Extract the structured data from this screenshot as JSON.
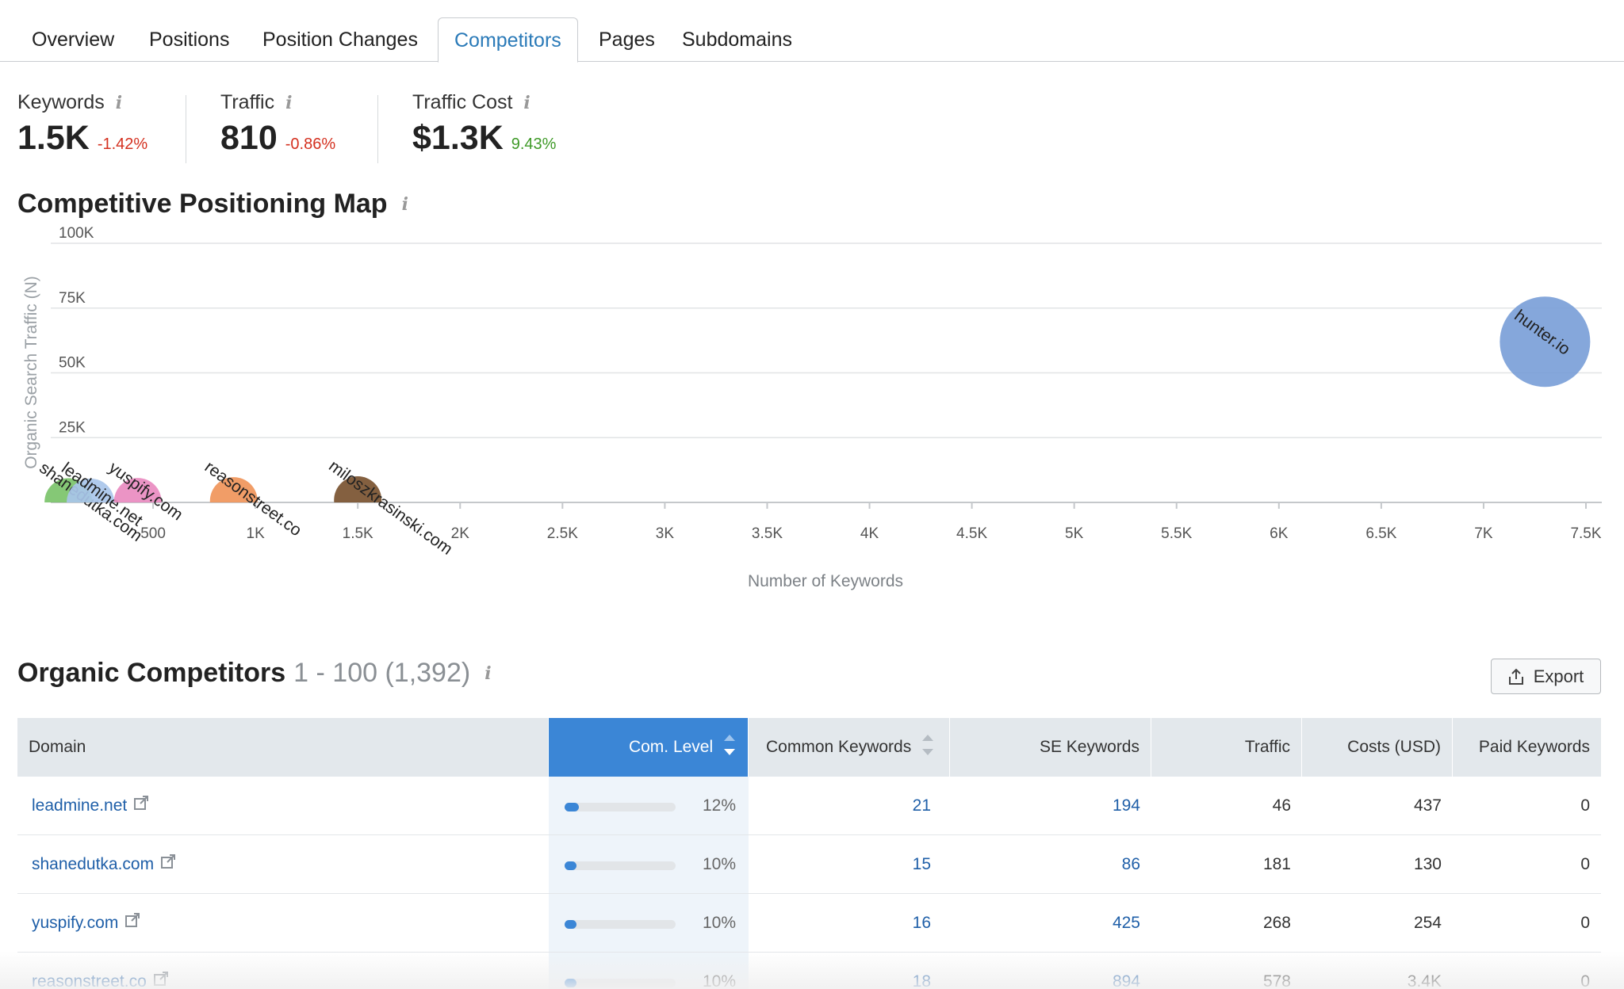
{
  "tabs": [
    {
      "label": "Overview"
    },
    {
      "label": "Positions"
    },
    {
      "label": "Position Changes"
    },
    {
      "label": "Competitors",
      "active": true
    },
    {
      "label": "Pages"
    },
    {
      "label": "Subdomains"
    }
  ],
  "metrics": [
    {
      "label": "Keywords",
      "value": "1.5K",
      "change": "-1.42%",
      "trend": "negative"
    },
    {
      "label": "Traffic",
      "value": "810",
      "change": "-0.86%",
      "trend": "negative"
    },
    {
      "label": "Traffic Cost",
      "value": "$1.3K",
      "change": "9.43%",
      "trend": "positive"
    }
  ],
  "map": {
    "title": "Competitive Positioning Map",
    "info_icon": "info-icon"
  },
  "chart_data": {
    "type": "scatter",
    "xlabel": "Number of Keywords",
    "ylabel": "Organic Search Traffic (N)",
    "xlim": [
      0,
      7500
    ],
    "ylim": [
      0,
      100000
    ],
    "x_ticks": [
      "500",
      "1K",
      "1.5K",
      "2K",
      "2.5K",
      "3K",
      "3.5K",
      "4K",
      "4.5K",
      "5K",
      "5.5K",
      "6K",
      "6.5K",
      "7K",
      "7.5K"
    ],
    "y_ticks": [
      "25K",
      "50K",
      "75K",
      "100K"
    ],
    "grid": true,
    "points": [
      {
        "label": "shanedutka.com",
        "x": 86,
        "y": 181,
        "color": "#7bc36a"
      },
      {
        "label": "leadmine.net",
        "x": 194,
        "y": 46,
        "color": "#a9c6ea"
      },
      {
        "label": "yuspify.com",
        "x": 425,
        "y": 268,
        "color": "#e98bc0"
      },
      {
        "label": "reasonstreet.co",
        "x": 894,
        "y": 578,
        "color": "#f0955a"
      },
      {
        "label": "miloszkrasinski.com",
        "x": 1500,
        "y": 900,
        "color": "#7a5230"
      },
      {
        "label": "hunter.io",
        "x": 7300,
        "y": 62000,
        "color": "#7b9fd8"
      }
    ]
  },
  "competitors": {
    "title": "Organic Competitors",
    "range": "1 - 100 (1,392)",
    "export_label": "Export",
    "columns": [
      "Domain",
      "Com. Level",
      "Common Keywords",
      "SE Keywords",
      "Traffic",
      "Costs (USD)",
      "Paid Keywords"
    ],
    "rows": [
      {
        "domain": "leadmine.net",
        "com_level": "12%",
        "com_level_value": 0.12,
        "common_keywords": "21",
        "se_keywords": "194",
        "traffic": "46",
        "costs": "437",
        "paid_keywords": "0"
      },
      {
        "domain": "shanedutka.com",
        "com_level": "10%",
        "com_level_value": 0.1,
        "common_keywords": "15",
        "se_keywords": "86",
        "traffic": "181",
        "costs": "130",
        "paid_keywords": "0"
      },
      {
        "domain": "yuspify.com",
        "com_level": "10%",
        "com_level_value": 0.1,
        "common_keywords": "16",
        "se_keywords": "425",
        "traffic": "268",
        "costs": "254",
        "paid_keywords": "0"
      },
      {
        "domain": "reasonstreet.co",
        "com_level": "10%",
        "com_level_value": 0.1,
        "common_keywords": "18",
        "se_keywords": "894",
        "traffic": "578",
        "costs": "3.4K",
        "paid_keywords": "0"
      }
    ]
  }
}
